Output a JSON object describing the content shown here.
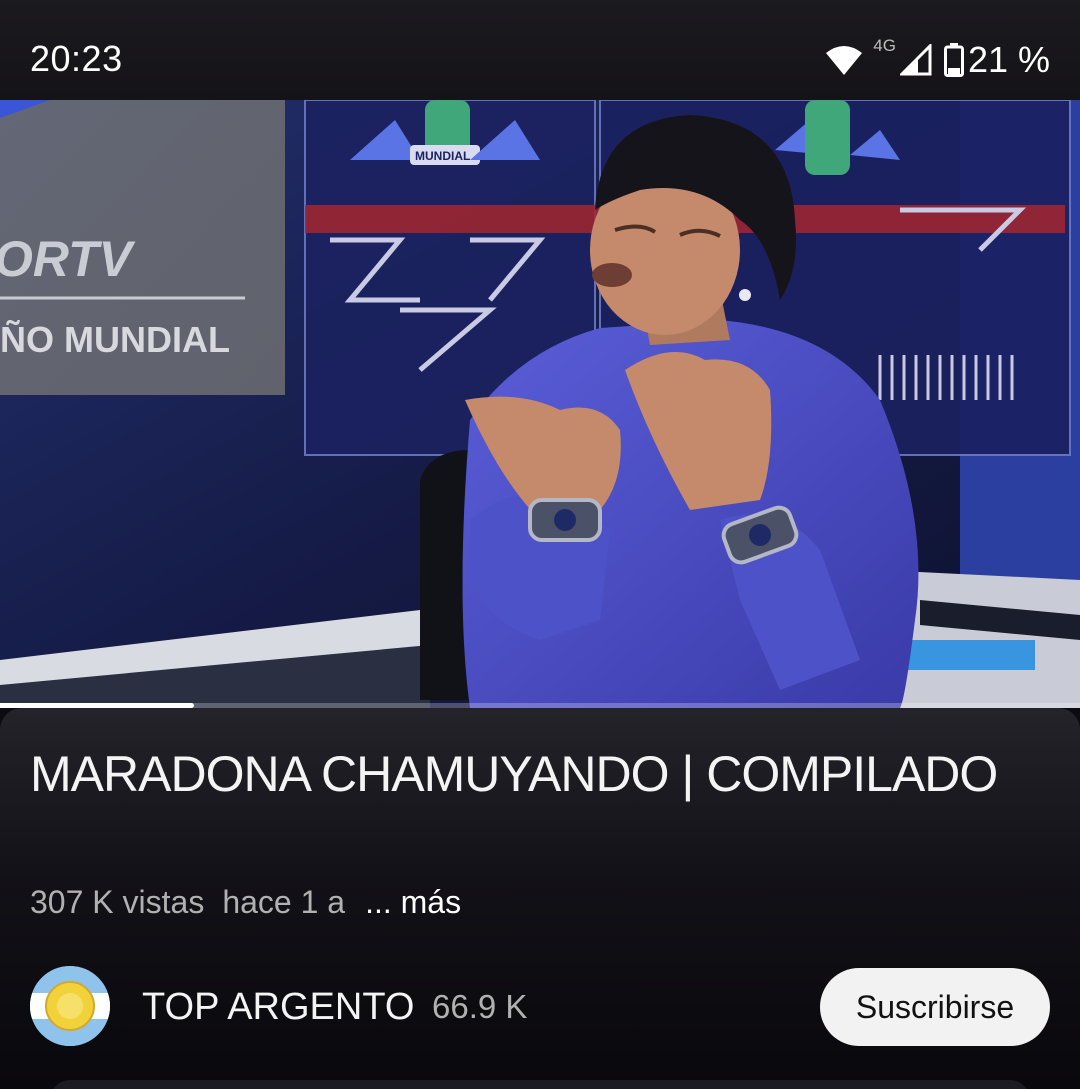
{
  "status_bar": {
    "time": "20:23",
    "network_type": "4G",
    "battery_percent": "21 %",
    "icons": [
      "wifi-icon",
      "signal-icon",
      "battery-icon"
    ]
  },
  "video": {
    "progress_fraction": 0.18,
    "overlay_texts": [
      "ORTV",
      "ÑO MUNDIAL",
      "MUNDIAL"
    ]
  },
  "details": {
    "title": "MARADONA CHAMUYANDO | COMPILADO",
    "views": "307 K vistas",
    "age": "hace 1 a",
    "more": "... más"
  },
  "channel": {
    "name": "TOP ARGENTO",
    "subscribers": "66.9 K",
    "subscribe_label": "Suscribirse",
    "avatar_text": "TOP ARGENTO"
  },
  "colors": {
    "background": "#0c0b10",
    "subscribe_bg": "#f2f2f2",
    "avatar_blue": "#8fc3ec",
    "avatar_sun": "#f2d23a"
  }
}
